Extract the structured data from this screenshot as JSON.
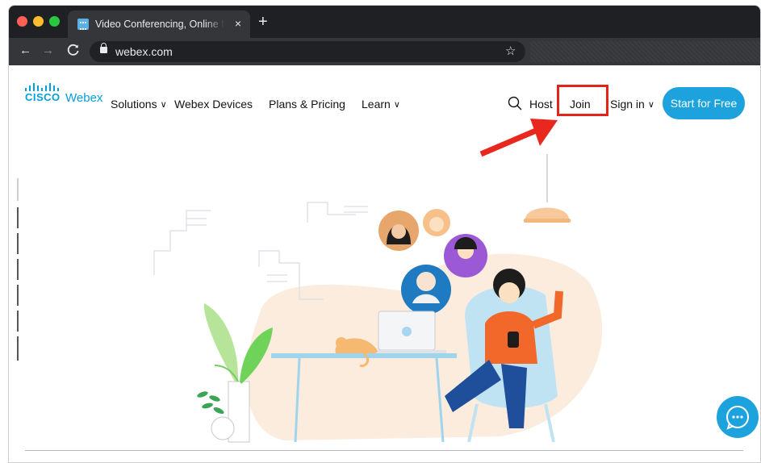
{
  "browser": {
    "tab_title": "Video Conferencing, Online Me",
    "close_glyph": "×",
    "new_tab_glyph": "+",
    "back_glyph": "←",
    "forward_glyph": "→",
    "reload_glyph": "C",
    "url": "webex.com",
    "star_glyph": "☆"
  },
  "header": {
    "logo_cisco": "CISCO",
    "logo_webex": "Webex",
    "nav": [
      {
        "label": "Solutions",
        "dropdown": true
      },
      {
        "label": "Webex Devices",
        "dropdown": false
      },
      {
        "label": "Plans & Pricing",
        "dropdown": false
      },
      {
        "label": "Learn",
        "dropdown": true
      }
    ],
    "chevron": "∨",
    "host_label": "Host",
    "join_label": "Join",
    "signin_label": "Sign in",
    "start_label": "Start for Free"
  },
  "icons": [
    "search-icon",
    "chat-icon",
    "lock-icon",
    "star-icon"
  ],
  "colors": {
    "brand": "#049fd9",
    "button": "#1ca3dd",
    "highlight": "#e3241b",
    "arrow": "#e8281f"
  }
}
